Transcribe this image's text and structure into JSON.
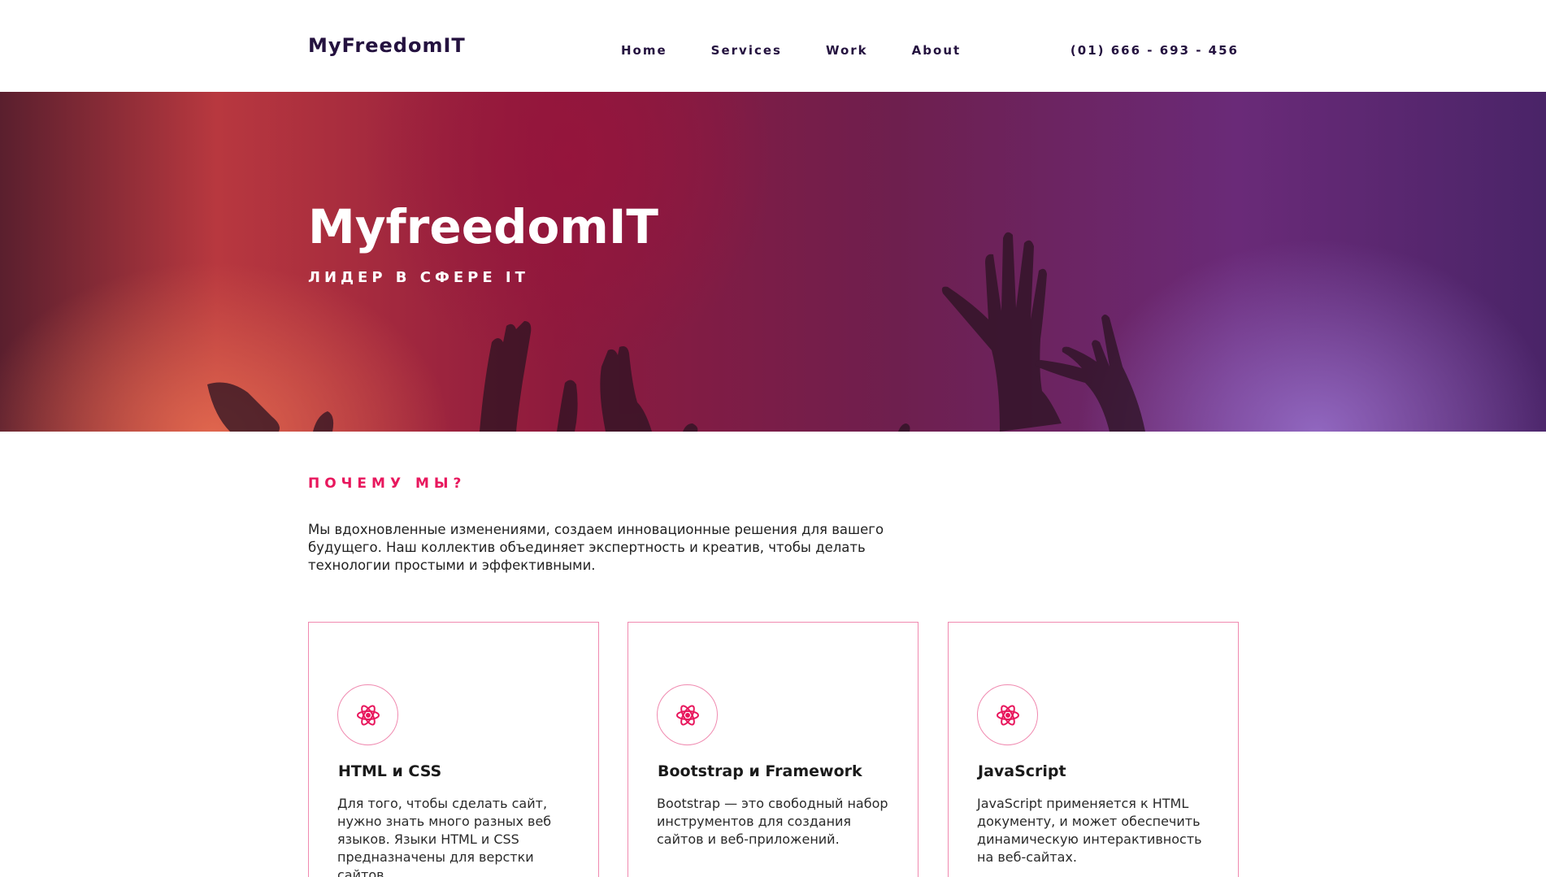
{
  "header": {
    "logo": "MyFreedomIT",
    "nav": [
      "Home",
      "Services",
      "Work",
      "About"
    ],
    "phone": "(01) 666 - 693 - 456"
  },
  "hero": {
    "title": "MyfreedomIT",
    "subtitle": "ЛИДЕР В СФЕРЕ IT"
  },
  "why": {
    "heading": "ПОЧЕМУ МЫ?",
    "text": "Мы вдохновленные изменениями, создаем инновационные решения для вашего будущего. Наш коллектив объединяет экспертность и креатив, чтобы делать технологии простыми и эффективными."
  },
  "cards": [
    {
      "icon": "atom-icon",
      "title": "HTML и CSS",
      "text": "Для того, чтобы сделать сайт, нужно знать много разных веб языков. Языки HTML и CSS предназначены для верстки сайтов."
    },
    {
      "icon": "atom-icon",
      "title": "Bootstrap и Framework",
      "text": "Bootstrap — это свободный набор инструментов для создания сайтов и веб-приложений."
    },
    {
      "icon": "atom-icon",
      "title": "JavaScript",
      "text": "JavaScript применяется к HTML документу, и может обеспечить динамическую интерактивность на веб-сайтах."
    }
  ],
  "colors": {
    "accent": "#e8175d",
    "brand_dark": "#24123f",
    "card_border": "#f08ab0"
  }
}
